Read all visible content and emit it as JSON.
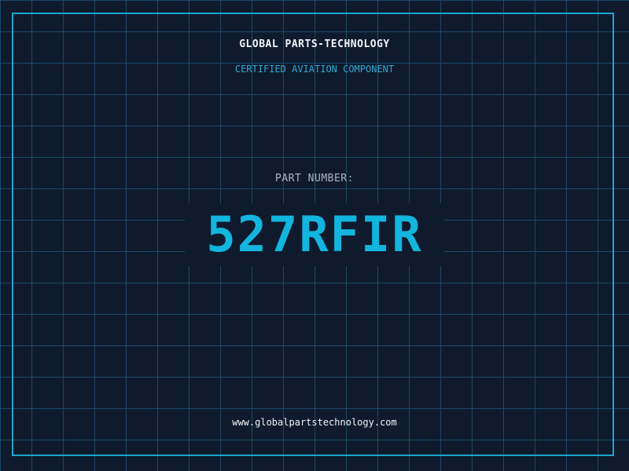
{
  "header": {
    "company_name": "GLOBAL PARTS-TECHNOLOGY",
    "tagline": "CERTIFIED AVIATION COMPONENT"
  },
  "part": {
    "label": "PART NUMBER:",
    "number": "527RFIR"
  },
  "footer": {
    "website": "www.globalpartstechnology.com"
  },
  "colors": {
    "background": "#0f1a2d",
    "grid": "#1c4a66",
    "accent": "#12b5de",
    "border": "#1aa6cc",
    "text_primary": "#f2f4f7",
    "text_secondary": "#a8b6c6"
  }
}
